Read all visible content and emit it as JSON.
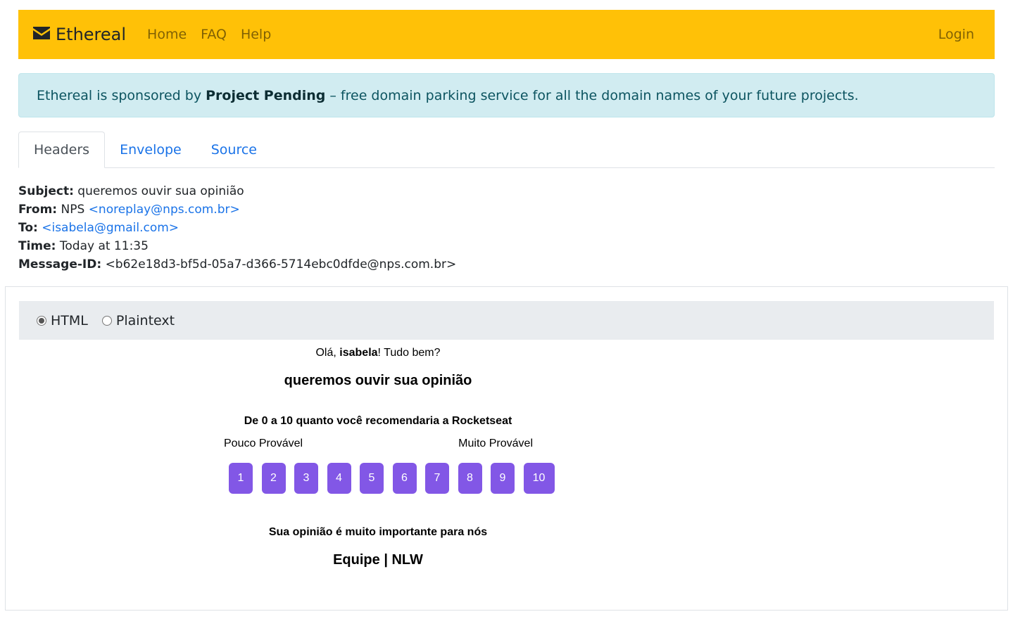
{
  "navbar": {
    "brand": "Ethereal",
    "brand_icon": "envelope-icon",
    "links": [
      "Home",
      "FAQ",
      "Help"
    ],
    "login": "Login",
    "bg_color": "#ffc107"
  },
  "alert": {
    "prefix": "Ethereal is sponsored by",
    "highlight": "Project Pending",
    "suffix": "– free domain parking service for all the domain names of your future projects."
  },
  "tabs": [
    {
      "label": "Headers",
      "active": true
    },
    {
      "label": "Envelope",
      "active": false
    },
    {
      "label": "Source",
      "active": false
    }
  ],
  "headers": {
    "subject_label": "Subject:",
    "subject": "queremos ouvir sua opinião",
    "from_label": "From:",
    "from_name": "NPS",
    "from_email": "<noreplay@nps.com.br>",
    "to_label": "To:",
    "to_email": "<isabela@gmail.com>",
    "time_label": "Time:",
    "time": "Today at 11:35",
    "message_id_label": "Message-ID:",
    "message_id": "<b62e18d3-bf5d-05a7-d366-5714ebc0dfde@nps.com.br>"
  },
  "view": {
    "html_label": "HTML",
    "plaintext_label": "Plaintext",
    "selected": "HTML"
  },
  "email": {
    "greeting_prefix": "Olá,",
    "greeting_name": "isabela",
    "greeting_suffix": "! Tudo bem?",
    "title": "queremos ouvir sua opinião",
    "question": "De 0 a 10 quanto você recomendaria a Rocketseat",
    "low_label": "Pouco Provável",
    "high_label": "Muito Provável",
    "scores": [
      "1",
      "2",
      "3",
      "4",
      "5",
      "6",
      "7",
      "8",
      "9",
      "10"
    ],
    "importance": "Sua opinião é muito importante para nós",
    "signature": "Equipe | NLW",
    "button_color": "#8257e6"
  }
}
